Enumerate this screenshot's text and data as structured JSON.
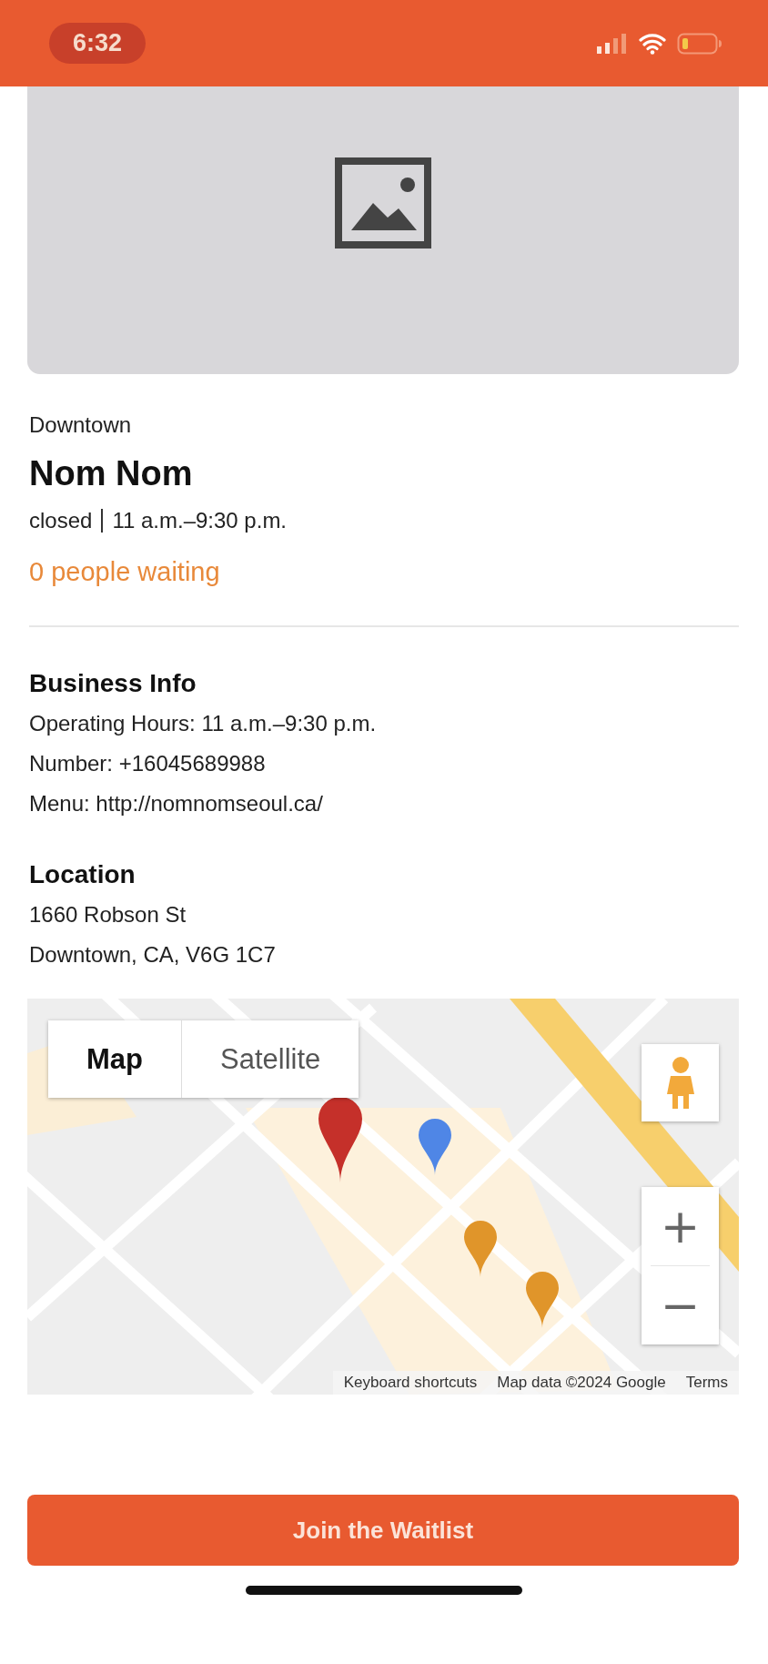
{
  "status_bar": {
    "time": "6:32"
  },
  "restaurant": {
    "neighborhood": "Downtown",
    "name": "Nom Nom",
    "status": "closed",
    "hours": "11 a.m.–9:30 p.m.",
    "waiting": "0 people waiting"
  },
  "sections": [
    {
      "title": "Business Info",
      "lines": [
        "Operating Hours: 11 a.m.–9:30 p.m.",
        "Number: +16045689988",
        "Menu: http://nomnomseoul.ca/"
      ]
    },
    {
      "title": "Location",
      "lines": [
        "1660 Robson St",
        "Downtown, CA, V6G 1C7"
      ]
    }
  ],
  "map": {
    "kind": "picture",
    "map_types": [
      {
        "label": "Map",
        "selected": true
      },
      {
        "label": "Satellite",
        "selected": false
      }
    ],
    "zoom_controls": [
      "+",
      "−"
    ],
    "footer_links": [
      "Keyboard shortcuts",
      "Map data ©2024 Google",
      "Terms"
    ]
  },
  "action_button": "Join the Waitlist"
}
